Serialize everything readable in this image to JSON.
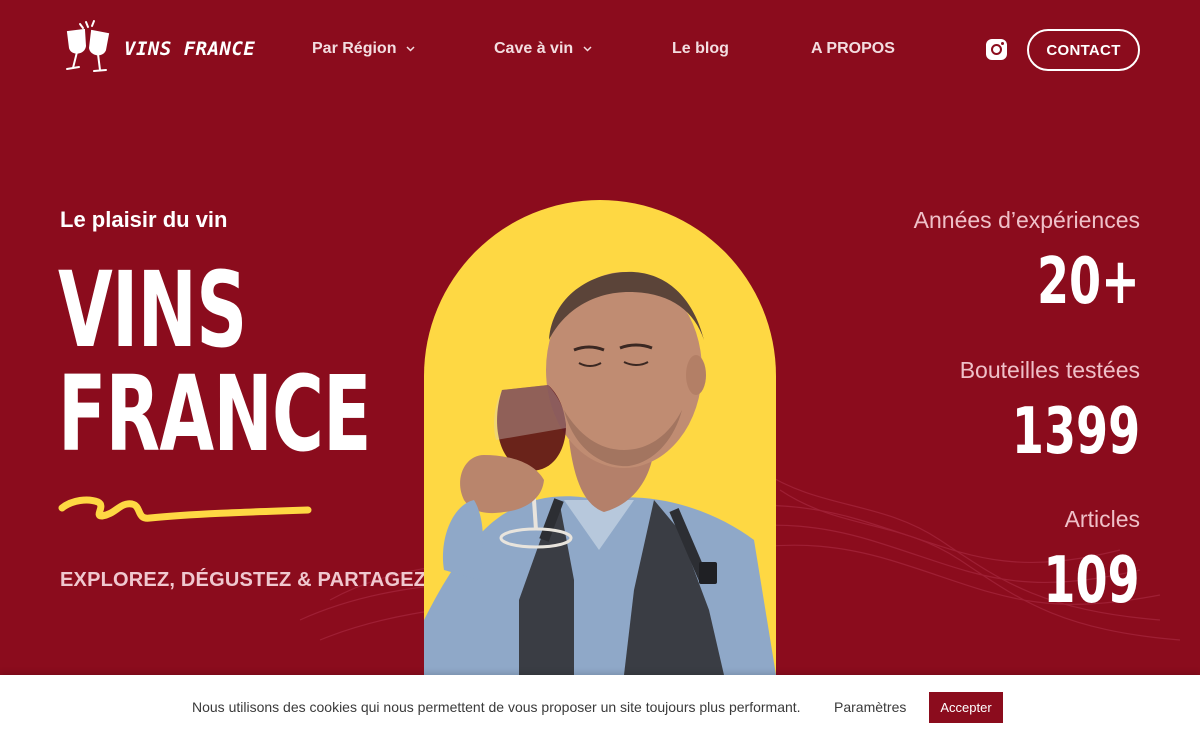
{
  "brand": {
    "name": "VINS FRANCE",
    "accent_color": "#8b0c1d",
    "highlight_color": "#fed843"
  },
  "nav": {
    "items": [
      {
        "label": "Par Région",
        "has_dropdown": true
      },
      {
        "label": "Cave à vin",
        "has_dropdown": true
      },
      {
        "label": "Le blog",
        "has_dropdown": false
      },
      {
        "label": "A PROPOS",
        "has_dropdown": false
      }
    ],
    "instagram_icon": "instagram-icon",
    "contact_label": "CONTACT"
  },
  "hero": {
    "tagline": "Le plaisir du vin",
    "title_line1": "VINS",
    "title_line2": "FRANCE",
    "subtitle": "EXPLOREZ, DÉGUSTEZ & PARTAGEZ",
    "image_subject": "man-tasting-red-wine-photo"
  },
  "stats": [
    {
      "label": "Années d’expériences",
      "value": "20+"
    },
    {
      "label": "Bouteilles testées",
      "value": "1399"
    },
    {
      "label": "Articles",
      "value": "109"
    }
  ],
  "cookie_banner": {
    "text": "Nous utilisons des cookies qui nous permettent de vous proposer un site toujours plus performant.",
    "settings_label": "Paramètres",
    "accept_label": "Accepter"
  }
}
